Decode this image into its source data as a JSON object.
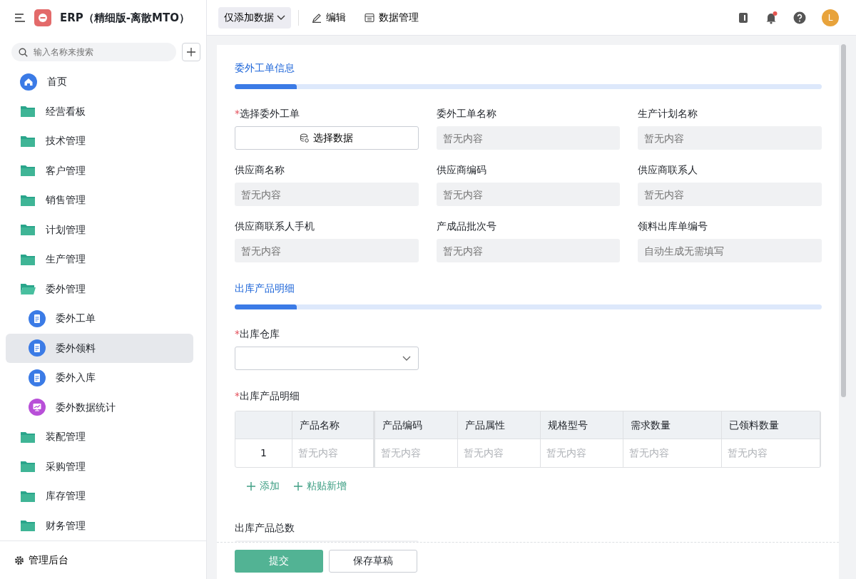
{
  "app": {
    "title": "ERP（精细版-离散MTO）",
    "search": {
      "placeholder": "输入名称来搜索"
    }
  },
  "sidebar": {
    "items": [
      {
        "label": "首页",
        "kind": "home",
        "selected": false
      },
      {
        "label": "经营看板",
        "kind": "folder",
        "selected": false,
        "expanded": false
      },
      {
        "label": "技术管理",
        "kind": "folder",
        "selected": false,
        "expanded": false
      },
      {
        "label": "客户管理",
        "kind": "folder",
        "selected": false,
        "expanded": false
      },
      {
        "label": "销售管理",
        "kind": "folder",
        "selected": false,
        "expanded": false
      },
      {
        "label": "计划管理",
        "kind": "folder",
        "selected": false,
        "expanded": false
      },
      {
        "label": "生产管理",
        "kind": "folder",
        "selected": false,
        "expanded": false
      },
      {
        "label": "委外管理",
        "kind": "folder",
        "selected": false,
        "expanded": true,
        "children": [
          {
            "label": "委外工单",
            "kind": "doc",
            "selected": false
          },
          {
            "label": "委外领料",
            "kind": "doc",
            "selected": true
          },
          {
            "label": "委外入库",
            "kind": "doc",
            "selected": false
          },
          {
            "label": "委外数据统计",
            "kind": "stats",
            "selected": false
          }
        ]
      },
      {
        "label": "装配管理",
        "kind": "folder",
        "selected": false,
        "expanded": false
      },
      {
        "label": "采购管理",
        "kind": "folder",
        "selected": false,
        "expanded": false
      },
      {
        "label": "库存管理",
        "kind": "folder",
        "selected": false,
        "expanded": false
      },
      {
        "label": "财务管理",
        "kind": "folder",
        "selected": false,
        "expanded": false
      }
    ],
    "footer": "管理后台"
  },
  "toolbar": {
    "mode": "仅添加数据",
    "avatar": "L",
    "actions": [
      {
        "label": "编辑",
        "kind": "edit"
      },
      {
        "label": "数据管理",
        "kind": "table"
      }
    ]
  },
  "form": {
    "sections": [
      {
        "title": "委外工单信息",
        "fields": [
          {
            "label": "选择委外工单",
            "required_mark": "*",
            "kind": "picker",
            "value": "选择数据"
          },
          {
            "label": "委外工单名称",
            "kind": "readonly",
            "placeholder": "暂无内容"
          },
          {
            "label": "生产计划名称",
            "kind": "readonly",
            "placeholder": "暂无内容"
          },
          {
            "label": "供应商名称",
            "kind": "readonly",
            "placeholder": "暂无内容"
          },
          {
            "label": "供应商编码",
            "kind": "readonly",
            "placeholder": "暂无内容"
          },
          {
            "label": "供应商联系人",
            "kind": "readonly",
            "placeholder": "暂无内容"
          },
          {
            "label": "供应商联系人手机",
            "kind": "readonly",
            "placeholder": "暂无内容"
          },
          {
            "label": "产成品批次号",
            "kind": "readonly",
            "placeholder": "暂无内容"
          },
          {
            "label": "领料出库单编号",
            "kind": "readonly",
            "placeholder": "自动生成无需填写"
          }
        ]
      },
      {
        "title": "出库产品明细",
        "fields": [
          {
            "label": "出库仓库",
            "required_mark": "*",
            "kind": "select"
          }
        ]
      }
    ],
    "table": {
      "label": "出库产品明细",
      "required_mark": "*",
      "columns": [
        "产品名称",
        "产品编码",
        "产品属性",
        "规格型号",
        "需求数量",
        "已领料数量"
      ],
      "rows": [
        {
          "index": "1",
          "cells": [
            "暂无内容",
            "暂无内容",
            "暂无内容",
            "暂无内容",
            "暂无内容",
            "暂无内容"
          ]
        }
      ],
      "actions": [
        "添加",
        "粘贴新增"
      ]
    },
    "total": {
      "label": "出库产品总数"
    }
  },
  "footer": {
    "buttons": [
      {
        "label": "提交",
        "kind": "primary"
      },
      {
        "label": "保存草稿",
        "kind": "secondary"
      }
    ]
  }
}
